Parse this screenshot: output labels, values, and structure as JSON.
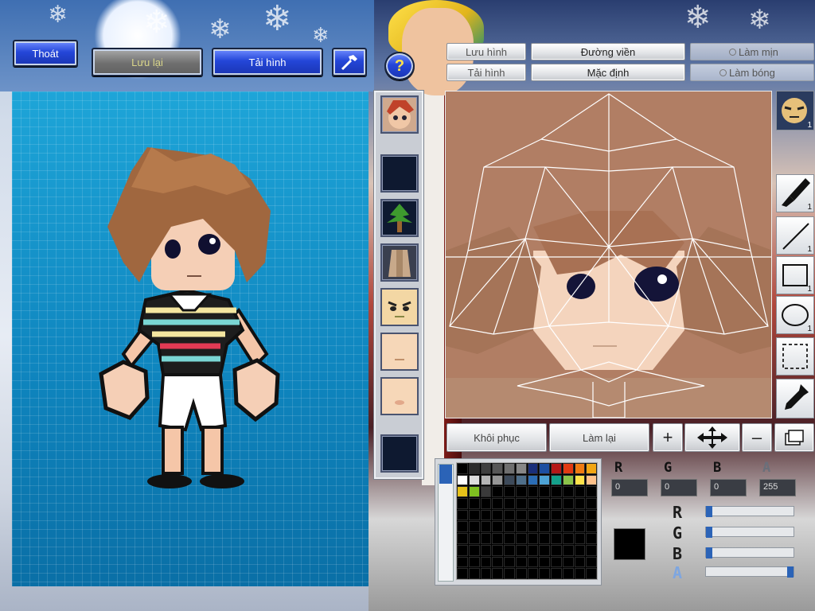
{
  "top_buttons": {
    "exit": "Thoát",
    "save": "Lưu lại",
    "reload": "Tải hình"
  },
  "texture_toolbar": {
    "save_image": "Lưu hình",
    "load_image": "Tải hình",
    "outline": "Đường viền",
    "default": "Mặc định",
    "smooth": "Làm mịn",
    "shade": "Làm bóng"
  },
  "bottom_buttons": {
    "restore": "Khôi phục",
    "redo": "Làm lại"
  },
  "tools": [
    {
      "icon": "brush-icon",
      "count": "1"
    },
    {
      "icon": "line-icon",
      "count": "1"
    },
    {
      "icon": "rectangle-icon",
      "count": "1"
    },
    {
      "icon": "ellipse-icon",
      "count": "1"
    },
    {
      "icon": "selection-icon",
      "count": ""
    },
    {
      "icon": "eyedropper-icon",
      "count": ""
    }
  ],
  "head_count": "1",
  "color": {
    "r": "0",
    "g": "0",
    "b": "0",
    "a": "255",
    "current": "#000000",
    "r_label": "R",
    "g_label": "G",
    "b_label": "B",
    "a_label": "A",
    "r_level": 0,
    "g_level": 0,
    "b_level": 0,
    "a_level": 1
  },
  "palette": [
    "#000000",
    "#2b2b2b",
    "#3f3f3f",
    "#575757",
    "#6f6f6f",
    "#878787",
    "#1a2f7a",
    "#1d4fa1",
    "#b51717",
    "#e23a12",
    "#f07b12",
    "#f2a614",
    "#ffffff",
    "#dddddd",
    "#b5b5b5",
    "#969696",
    "#3d4a5a",
    "#4f6f8a",
    "#2b6db5",
    "#4da2d5",
    "#14a08a",
    "#8bc34a",
    "#ffe24a",
    "#ffc18a",
    "#e6c21a",
    "#7ec020",
    "#3a3a3a"
  ]
}
